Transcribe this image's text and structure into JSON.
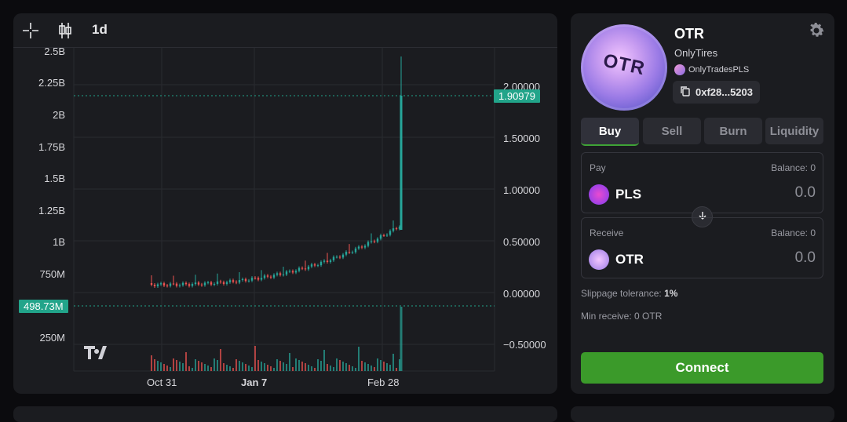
{
  "chart": {
    "interval": "1d",
    "left_axis": [
      "2.5B",
      "2.25B",
      "2B",
      "1.75B",
      "1.5B",
      "1.25B",
      "1B",
      "750M",
      "250M"
    ],
    "right_axis": [
      "2.00000",
      "1.50000",
      "1.00000",
      "0.50000",
      "0.00000",
      "−0.50000"
    ],
    "x_axis": [
      "Oct 31",
      "Jan 7",
      "Feb 28"
    ],
    "price_tag": "1.90979",
    "volume_tag": "498.73M",
    "watermark": "TV",
    "colors": {
      "up": "#26a69a",
      "down": "#ef5350",
      "tag": "#22a48a"
    }
  },
  "token": {
    "symbol": "OTR",
    "name": "OnlyTires",
    "handle": "OnlyTradesPLS",
    "address": "0xf28...5203",
    "coin_text": "OTR"
  },
  "tabs": [
    "Buy",
    "Sell",
    "Burn",
    "Liquidity"
  ],
  "pay": {
    "label": "Pay",
    "balance": "Balance: 0",
    "token": "PLS",
    "amount": "0.0"
  },
  "receive": {
    "label": "Receive",
    "balance": "Balance: 0",
    "token": "OTR",
    "amount": "0.0"
  },
  "slippage": {
    "label": "Slippage tolerance:",
    "value": "1%"
  },
  "min_receive": "Min receive: 0 OTR",
  "connect_label": "Connect"
}
